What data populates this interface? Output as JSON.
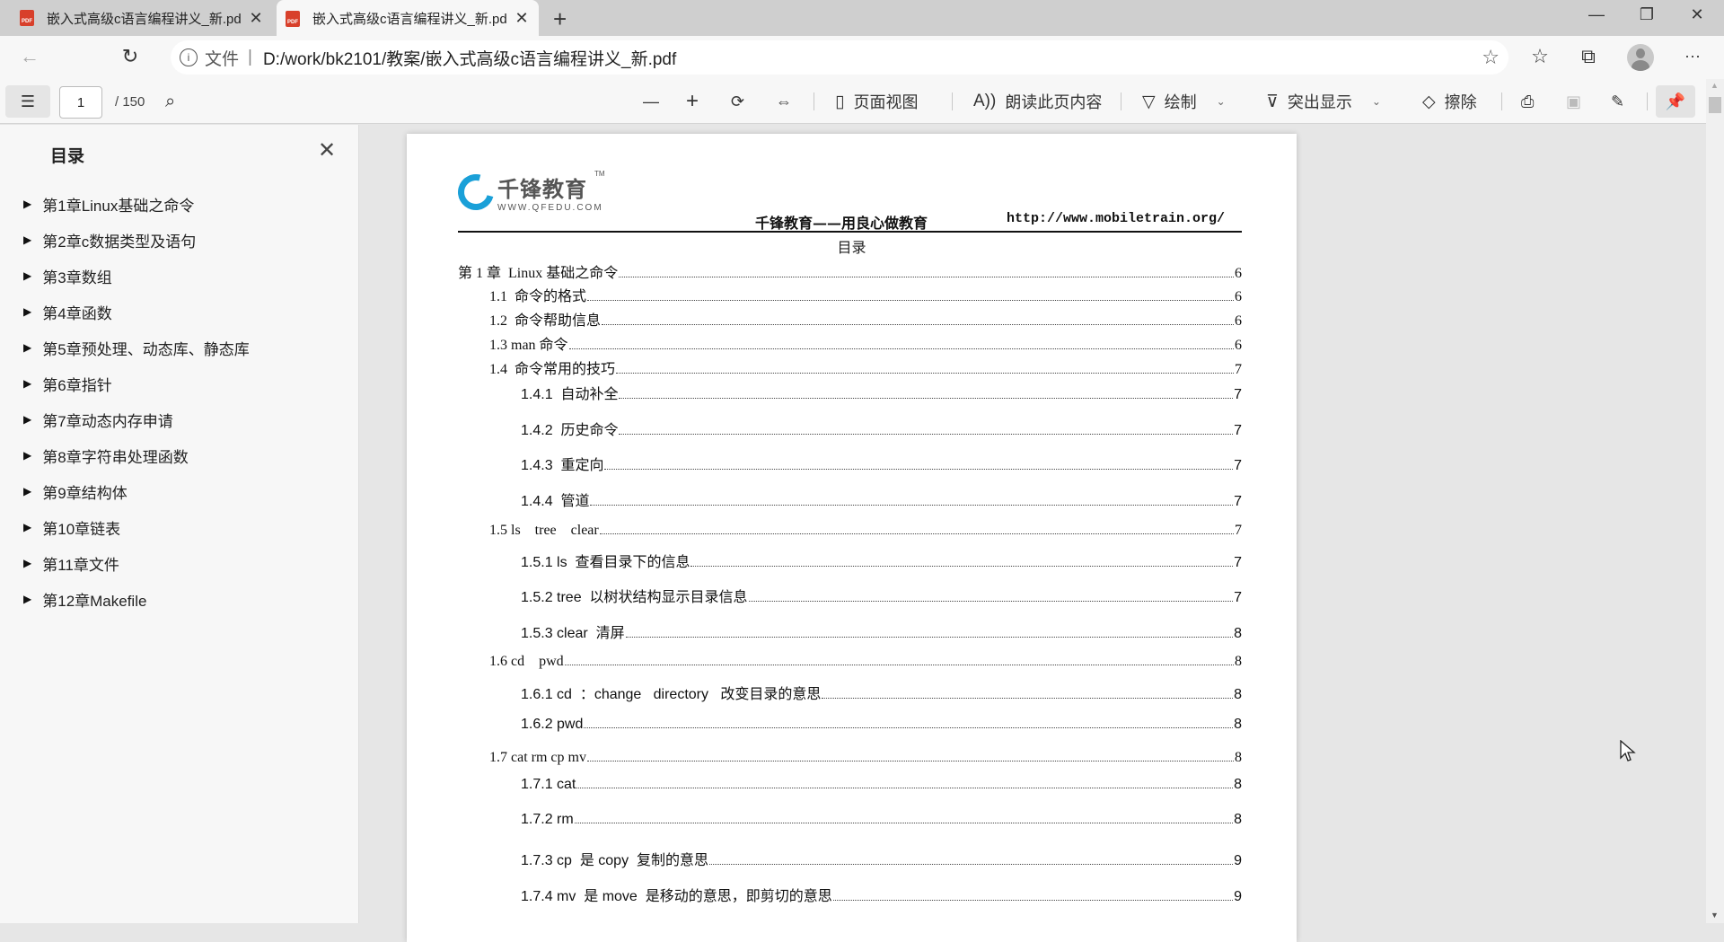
{
  "browser": {
    "tabs": [
      {
        "title": "嵌入式高级c语言编程讲义_新.pdf",
        "icon": "pdf-icon",
        "active": false
      },
      {
        "title": "嵌入式高级c语言编程讲义_新.pdf",
        "icon": "pdf-icon",
        "active": true
      }
    ],
    "new_tab": "+",
    "window": {
      "minimize": "—",
      "maximize": "❐",
      "close": "✕"
    },
    "address": {
      "scheme_label": "文件",
      "separator": "|",
      "url": "D:/work/bk2101/教案/嵌入式高级c语言编程讲义_新.pdf"
    },
    "nav": {
      "back": "←",
      "refresh": "↻"
    },
    "toolbar_icons": [
      "add-favorite-icon",
      "favorites-icon",
      "collections-icon",
      "profile-avatar",
      "more-icon"
    ],
    "more_label": "···"
  },
  "pdf_toolbar": {
    "current_page": "1",
    "total_pages": "/ 150",
    "zoom_out": "—",
    "zoom_in": "+",
    "page_view_label": "页面视图",
    "read_aloud_label": "朗读此页内容",
    "draw_label": "绘制",
    "highlight_label": "突出显示",
    "erase_label": "擦除"
  },
  "sidebar": {
    "title": "目录",
    "items": [
      {
        "label": "第1章Linux基础之命令"
      },
      {
        "label": "第2章c数据类型及语句"
      },
      {
        "label": "第3章数组"
      },
      {
        "label": "第4章函数"
      },
      {
        "label": "第5章预处理、动态库、静态库"
      },
      {
        "label": "第6章指针"
      },
      {
        "label": "第7章动态内存申请"
      },
      {
        "label": "第8章字符串处理函数"
      },
      {
        "label": "第9章结构体"
      },
      {
        "label": "第10章链表"
      },
      {
        "label": "第11章文件"
      },
      {
        "label": "第12章Makefile"
      }
    ]
  },
  "page": {
    "logo_cn": "千锋教育",
    "logo_en": "WWW.QFEDU.COM",
    "logo_tm": "TM",
    "slogan": "千锋教育——用良心做教育",
    "url": "http://www.mobiletrain.org/",
    "title": "目录",
    "toc": [
      {
        "level": 1,
        "label": "第 1 章  Linux 基础之命令",
        "page": "6"
      },
      {
        "level": 2,
        "label": "1.1  命令的格式",
        "page": "6"
      },
      {
        "level": 2,
        "label": "1.2  命令帮助信息",
        "page": "6"
      },
      {
        "level": 2,
        "label": "1.3 man 命令",
        "page": "6"
      },
      {
        "level": 2,
        "label": "1.4  命令常用的技巧",
        "page": "7"
      },
      {
        "level": 3,
        "label": "1.4.1  自动补全",
        "page": "7"
      },
      {
        "level": 3,
        "label": "1.4.2  历史命令",
        "page": "7"
      },
      {
        "level": 3,
        "label": "1.4.3  重定向",
        "page": "7"
      },
      {
        "level": 3,
        "label": "1.4.4  管道",
        "page": "7"
      },
      {
        "level": 2,
        "label": "1.5 ls    tree    clear",
        "page": "7"
      },
      {
        "level": 3,
        "label": "1.5.1 ls  查看目录下的信息",
        "page": "7"
      },
      {
        "level": 3,
        "label": "1.5.2 tree  以树状结构显示目录信息",
        "page": "7"
      },
      {
        "level": 3,
        "label": "1.5.3 clear  清屏",
        "page": "8"
      },
      {
        "level": 2,
        "label": "1.6 cd    pwd",
        "page": "8"
      },
      {
        "level": 3,
        "label": "1.6.1 cd  ：change   directory   改变目录的意思",
        "page": "8"
      },
      {
        "level": 3,
        "label": "1.6.2 pwd",
        "page": "8"
      },
      {
        "level": 2,
        "label": "1.7 cat rm cp mv",
        "page": "8"
      },
      {
        "level": 3,
        "label": "1.7.1 cat",
        "page": "8"
      },
      {
        "level": 3,
        "label": "1.7.2 rm",
        "page": "8"
      },
      {
        "level": 3,
        "label": "1.7.3 cp  是 copy  复制的意思",
        "page": "9"
      },
      {
        "level": 3,
        "label": "1.7.4 mv  是 move  是移动的意思，即剪切的意思",
        "page": "9"
      }
    ]
  },
  "colors": {
    "tabstrip": "#cfcfcf",
    "toolbar": "#f7f7f7",
    "viewer_bg": "#e6e6e6",
    "pdf_icon": "#d8402b",
    "logo_blue": "#1aa0d8"
  }
}
